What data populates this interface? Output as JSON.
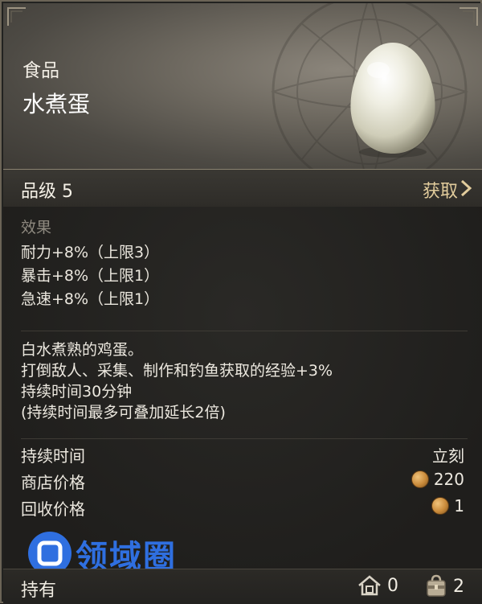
{
  "item": {
    "category": "食品",
    "name": "水煮蛋",
    "icon": "boiled-egg-icon"
  },
  "grade": {
    "label": "品级 5",
    "acquire_label": "获取"
  },
  "effects": {
    "title": "效果",
    "lines": [
      "耐力+8%（上限3）",
      "暴击+8%（上限1）",
      "急速+8%（上限1）"
    ]
  },
  "description": [
    "白水煮熟的鸡蛋。",
    "打倒敌人、采集、制作和钓鱼获取的经验+3%",
    "持续时间30分钟",
    "(持续时间最多可叠加延长2倍)"
  ],
  "stats": [
    {
      "label": "持续时间",
      "value": "立刻",
      "coin": false
    },
    {
      "label": "商店价格",
      "value": "220",
      "coin": true
    },
    {
      "label": "回收价格",
      "value": "1",
      "coin": true
    }
  ],
  "watermark": {
    "text": "领域圈"
  },
  "footer": {
    "label": "持有",
    "house_count": "0",
    "bag_count": "2"
  },
  "colors": {
    "acquire": "#e2cc9c",
    "section_title": "#8f8a80",
    "watermark": "#2f6fe0"
  }
}
